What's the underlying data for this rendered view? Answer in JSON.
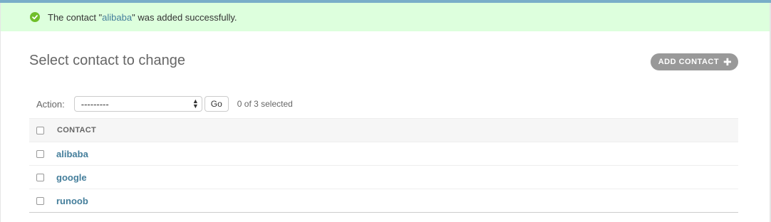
{
  "message": {
    "prefix": "The contact \"",
    "link": "alibaba",
    "suffix": "\" was added successfully."
  },
  "page": {
    "title": "Select contact to change",
    "add_button": "ADD CONTACT"
  },
  "actions": {
    "label": "Action:",
    "selected_option": "---------",
    "go_button": "Go",
    "counter": "0 of 3 selected"
  },
  "table": {
    "column_header": "CONTACT",
    "rows": [
      {
        "name": "alibaba"
      },
      {
        "name": "google"
      },
      {
        "name": "runoob"
      }
    ]
  },
  "colors": {
    "accent": "#79aec8",
    "link": "#447e9b",
    "success_bg": "#ddffdd",
    "success_icon": "#70bf2b",
    "add_button_bg": "#999999"
  }
}
